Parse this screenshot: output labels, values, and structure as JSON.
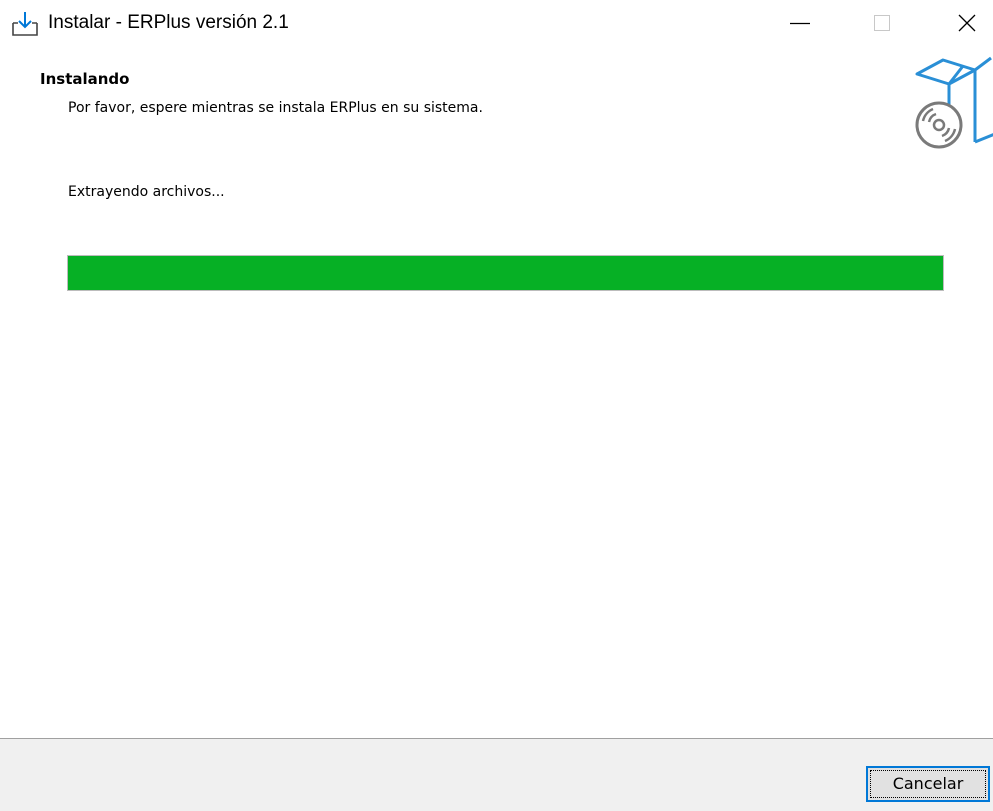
{
  "window": {
    "title": "Instalar - ERPlus versión 2.1",
    "icons": {
      "app": "install-download-icon",
      "minimize": "minimize-icon",
      "maximize": "maximize-icon",
      "close": "close-icon"
    }
  },
  "header": {
    "heading": "Instalando",
    "subheading": "Por favor, espere mientras se instala ERPlus en su sistema.",
    "graphic": "software-box-with-disc-icon"
  },
  "body": {
    "status": "Extrayendo archivos...",
    "progress": {
      "percent": 100,
      "color": "#06b025"
    }
  },
  "footer": {
    "cancel_label": "Cancelar"
  },
  "colors": {
    "accent": "#0078d7",
    "progress_green": "#06b025",
    "footer_bg": "#f0f0f0"
  }
}
